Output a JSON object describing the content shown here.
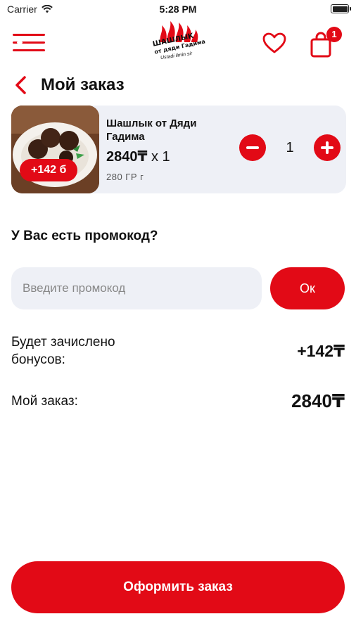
{
  "status_bar": {
    "carrier": "Carrier",
    "time": "5:28 PM"
  },
  "header": {
    "logo_title": "ШАШЛЫК",
    "logo_subtitle": "от дяди Гадима",
    "logo_tagline": "Ustadi ilmin sir",
    "cart_count": "1",
    "icons": [
      "menu-icon",
      "heart-icon",
      "cart-icon"
    ]
  },
  "page": {
    "title": "Мой заказ"
  },
  "cart_item": {
    "name": "Шашлык от Дяди Гадима",
    "price": "2840₸",
    "multiplier": "x 1",
    "weight": "280 ГР г",
    "bonus_badge": "+142 б",
    "quantity": "1"
  },
  "promo": {
    "title": "У Вас есть промокод?",
    "placeholder": "Введите промокод",
    "value": "",
    "apply_label": "Ок"
  },
  "summary": {
    "bonus_label": "Будет зачислено бонусов:",
    "bonus_value": "+142₸",
    "order_label": "Мой заказ:",
    "order_value": "2840₸"
  },
  "checkout": {
    "label": "Оформить заказ"
  },
  "colors": {
    "accent": "#e20a16",
    "card_bg": "#eef0f6",
    "text": "#111111"
  }
}
